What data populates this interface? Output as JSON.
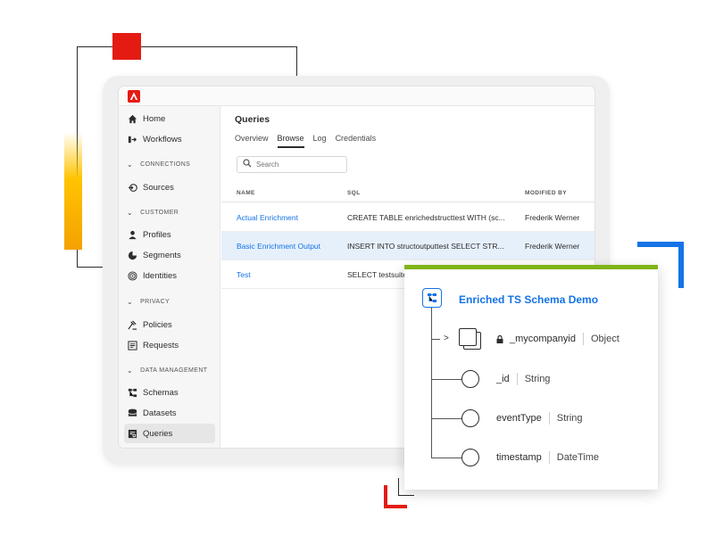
{
  "sidebar": {
    "items": [
      {
        "label": "Home",
        "icon": "home-icon"
      },
      {
        "label": "Workflows",
        "icon": "workflow-icon"
      },
      {
        "label": "CONNECTIONS",
        "section": true
      },
      {
        "label": "Sources",
        "icon": "sources-icon"
      },
      {
        "label": "CUSTOMER",
        "section": true
      },
      {
        "label": "Profiles",
        "icon": "profile-icon"
      },
      {
        "label": "Segments",
        "icon": "segments-icon"
      },
      {
        "label": "Identities",
        "icon": "identities-icon"
      },
      {
        "label": "PRIVACY",
        "section": true
      },
      {
        "label": "Policies",
        "icon": "policies-icon"
      },
      {
        "label": "Requests",
        "icon": "requests-icon"
      },
      {
        "label": "DATA MANAGEMENT",
        "section": true
      },
      {
        "label": "Schemas",
        "icon": "schemas-icon"
      },
      {
        "label": "Datasets",
        "icon": "datasets-icon"
      },
      {
        "label": "Queries",
        "icon": "queries-icon",
        "active": true
      }
    ]
  },
  "main": {
    "title": "Queries",
    "tabs": [
      {
        "label": "Overview"
      },
      {
        "label": "Browse",
        "active": true
      },
      {
        "label": "Log"
      },
      {
        "label": "Credentials"
      }
    ],
    "search": {
      "placeholder": "Search"
    },
    "table": {
      "columns": [
        "NAME",
        "SQL",
        "MODIFIED BY"
      ],
      "rows": [
        {
          "name": "Actual Enrichment",
          "sql": "CREATE TABLE enrichedstructtest WITH (sc...",
          "modified_by": "Frederik Werner"
        },
        {
          "name": "Basic Enrichment Output",
          "sql": "INSERT INTO structoutputtest SELECT STR...",
          "modified_by": "Frederik Werner",
          "selected": true
        },
        {
          "name": "Test",
          "sql": "SELECT testsuite_",
          "modified_by": ""
        }
      ]
    }
  },
  "schema_card": {
    "title": "Enriched TS Schema Demo",
    "fields": [
      {
        "name": "_mycompanyid",
        "type": "Object",
        "locked": true,
        "expandable": true
      },
      {
        "name": "_id",
        "type": "String"
      },
      {
        "name": "eventType",
        "type": "String"
      },
      {
        "name": "timestamp",
        "type": "DateTime"
      }
    ]
  },
  "colors": {
    "accent_blue": "#1473e6",
    "adobe_red": "#e41b13",
    "green_bar": "#7fb418",
    "yellow": "#ffc400"
  }
}
